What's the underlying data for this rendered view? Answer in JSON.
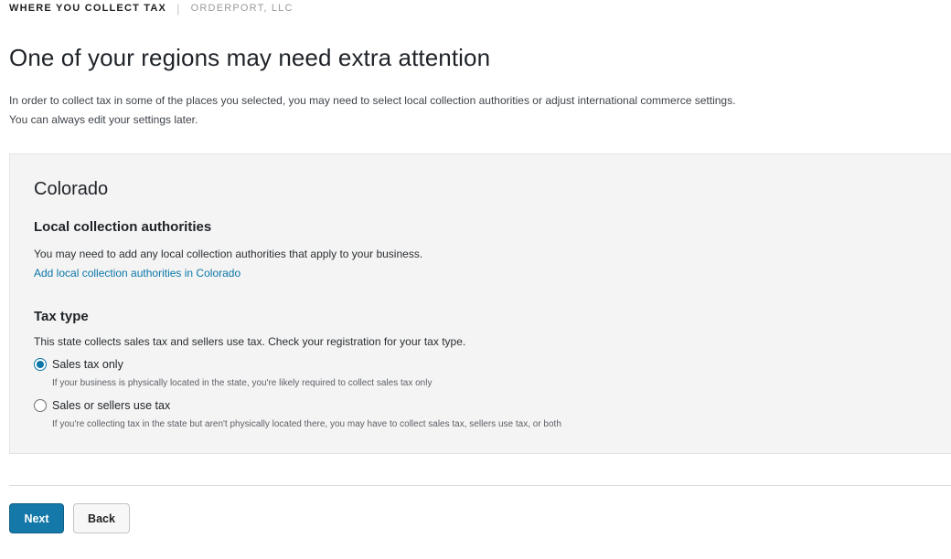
{
  "breadcrumb": {
    "primary": "WHERE YOU COLLECT TAX",
    "secondary": "ORDERPORT, LLC"
  },
  "page_title": "One of your regions may need extra attention",
  "intro": {
    "line1": "In order to collect tax in some of the places you selected, you may need to select local collection authorities or adjust international commerce settings.",
    "line2": "You can always edit your settings later."
  },
  "region": {
    "name": "Colorado",
    "local_authorities": {
      "heading": "Local collection authorities",
      "description": "You may need to add any local collection authorities that apply to your business.",
      "link_label": "Add local collection authorities in Colorado"
    },
    "tax_type": {
      "heading": "Tax type",
      "description": "This state collects sales tax and sellers use tax. Check your registration for your tax type.",
      "options": [
        {
          "label": "Sales tax only",
          "help": "If your business is physically located in the state, you're likely required to collect sales tax only",
          "selected": true
        },
        {
          "label": "Sales or sellers use tax",
          "help": "If you're collecting tax in the state but aren't physically located there, you may have to collect sales tax, sellers use tax, or both",
          "selected": false
        }
      ]
    }
  },
  "actions": {
    "next_label": "Next",
    "back_label": "Back"
  },
  "colors": {
    "accent": "#0b76a8",
    "primary_button": "#1479a8",
    "panel_background": "#f4f4f4"
  }
}
